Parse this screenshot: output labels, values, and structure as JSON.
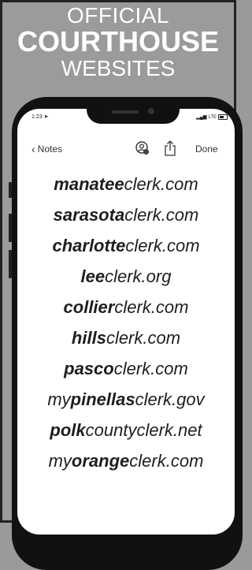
{
  "header": {
    "line1": "OFFICIAL",
    "line2": "COURTHOUSE",
    "line3": "WEBSITES"
  },
  "status": {
    "time": "1:23",
    "network": "LTE"
  },
  "toolbar": {
    "back_label": "Notes",
    "done_label": "Done"
  },
  "icons": {
    "collaborate": "add-person-icon",
    "share": "share-icon"
  },
  "notes": [
    {
      "prefix": "",
      "bold": "manatee",
      "suffix": "clerk.com"
    },
    {
      "prefix": "",
      "bold": "sarasota",
      "suffix": "clerk.com"
    },
    {
      "prefix": "",
      "bold": "charlotte",
      "suffix": "clerk.com"
    },
    {
      "prefix": "",
      "bold": "lee",
      "suffix": "clerk.org"
    },
    {
      "prefix": "",
      "bold": "collier",
      "suffix": "clerk.com"
    },
    {
      "prefix": "",
      "bold": "hills",
      "suffix": "clerk.com"
    },
    {
      "prefix": "",
      "bold": "pasco",
      "suffix": "clerk.com"
    },
    {
      "prefix": "my",
      "bold": "pinellas",
      "suffix": "clerk.gov"
    },
    {
      "prefix": "",
      "bold": "polk",
      "suffix": "countyclerk.net"
    },
    {
      "prefix": "my",
      "bold": "orange",
      "suffix": "clerk.com"
    }
  ]
}
